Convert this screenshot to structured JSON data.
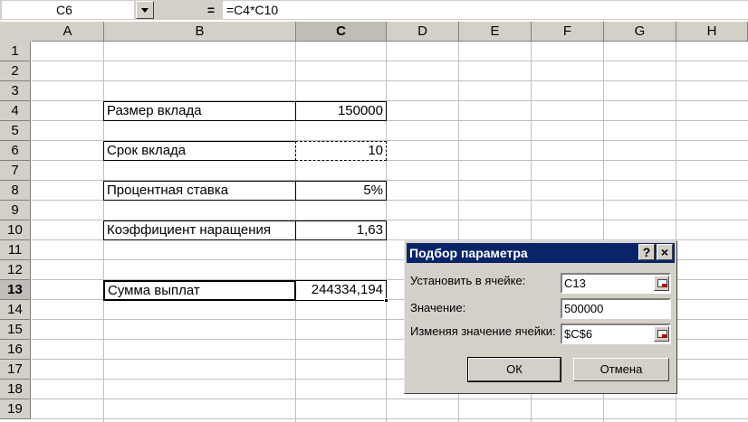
{
  "formula_bar": {
    "name_box": "C6",
    "equals": "=",
    "formula": "=C4*C10"
  },
  "columns": [
    "A",
    "B",
    "C",
    "D",
    "E",
    "F",
    "G",
    "H"
  ],
  "selected_column": "C",
  "rows": [
    "1",
    "2",
    "3",
    "4",
    "5",
    "6",
    "7",
    "8",
    "9",
    "10",
    "11",
    "12",
    "13",
    "14",
    "15",
    "16",
    "17",
    "18",
    "19"
  ],
  "selected_row": "13",
  "cells": {
    "b4": "Размер вклада",
    "c4": "150000",
    "b6": "Срок вклада",
    "c6": "10",
    "b8": "Процентная ставка",
    "c8": "5%",
    "b10": "Коэффициент наращения",
    "c10": "1,63",
    "b13": "Сумма выплат",
    "c13": "244334,194"
  },
  "dialog": {
    "title": "Подбор параметра",
    "help_button": "?",
    "close_button": "×",
    "set_cell_label": "Установить в ячейке:",
    "set_cell_value": "C13",
    "value_label": "Значение:",
    "value_value": "500000",
    "changing_cell_label": "Изменяя значение ячейки:",
    "changing_cell_value": "$C$6",
    "ok_label": "ОК",
    "cancel_label": "Отмена"
  }
}
